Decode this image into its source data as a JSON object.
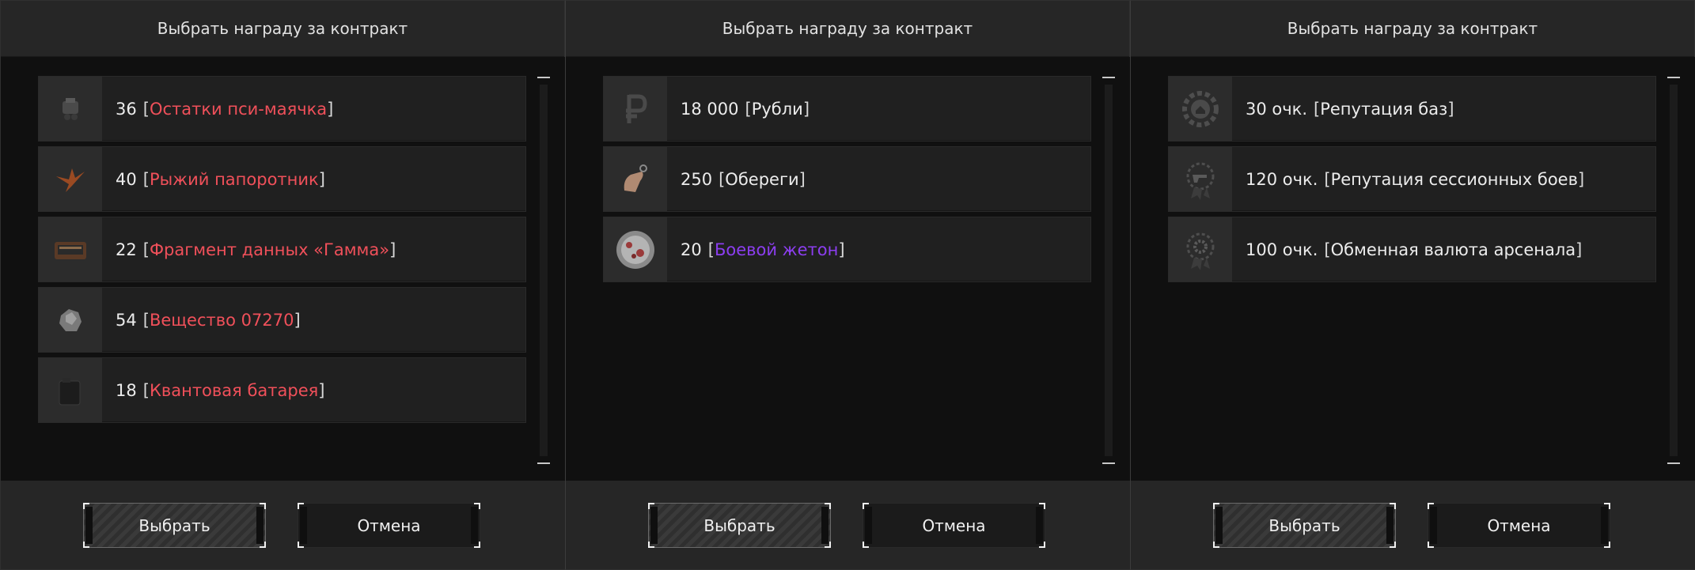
{
  "panels": [
    {
      "title": "Выбрать награду за контракт",
      "items": [
        {
          "qty": "36",
          "open": "[",
          "name": "Остатки пси-маячка",
          "close": "]",
          "icon": "psi-beacon-icon"
        },
        {
          "qty": "40",
          "open": "[",
          "name": "Рыжий папоротник",
          "close": "]",
          "icon": "fern-icon"
        },
        {
          "qty": "22",
          "open": "[",
          "name": "Фрагмент данных «Гамма»",
          "close": "]",
          "icon": "data-fragment-icon"
        },
        {
          "qty": "54",
          "open": "[",
          "name": "Вещество 07270",
          "close": "]",
          "icon": "substance-icon"
        },
        {
          "qty": "18",
          "open": "[",
          "name": "Квантовая батарея",
          "close": "]",
          "icon": "battery-icon"
        }
      ],
      "select_label": "Выбрать",
      "cancel_label": "Отмена"
    },
    {
      "title": "Выбрать награду за контракт",
      "items": [
        {
          "qty": "18 000",
          "open": "[",
          "name": "Рубли",
          "close": "]",
          "icon": "ruble-icon"
        },
        {
          "qty": "250",
          "open": "[",
          "name": "Обереги",
          "close": "]",
          "icon": "amulet-icon"
        },
        {
          "qty": "20",
          "open": "[",
          "name": "Боевой жетон",
          "close": "]",
          "icon": "battle-token-icon"
        }
      ],
      "select_label": "Выбрать",
      "cancel_label": "Отмена"
    },
    {
      "title": "Выбрать награду за контракт",
      "items": [
        {
          "qty": "30 очк.",
          "open": "[",
          "name": "Репутация баз",
          "close": "]",
          "icon": "base-reputation-icon"
        },
        {
          "qty": "120 очк.",
          "open": "[",
          "name": "Репутация сессионных боев",
          "close": "]",
          "icon": "session-reputation-icon"
        },
        {
          "qty": "100 очк.",
          "open": "[",
          "name": "Обменная валюта арсенала",
          "close": "]",
          "icon": "arsenal-currency-icon"
        }
      ],
      "select_label": "Выбрать",
      "cancel_label": "Отмена"
    }
  ],
  "colors": {
    "rarity_red": "#f0505a",
    "rarity_purple": "#8c3ef0",
    "cancel_accent": "#e0404a"
  }
}
